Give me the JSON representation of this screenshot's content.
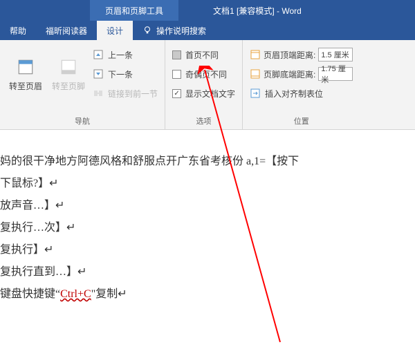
{
  "title": {
    "tool_tab": "页眉和页脚工具",
    "doc": "文档1 [兼容模式]  -  Word"
  },
  "tabs": {
    "help": "帮助",
    "foxit": "福昕阅读器",
    "design": "设计",
    "tell_me": "操作说明搜索"
  },
  "nav": {
    "goto_header": "转至页眉",
    "goto_footer": "转至页脚",
    "prev": "上一条",
    "next": "下一条",
    "link_prev": "链接到前一节",
    "group": "导航"
  },
  "options": {
    "diff_first": "首页不同",
    "diff_odd_even": "奇偶页不同",
    "show_doc": "显示文档文字",
    "group": "选项"
  },
  "position": {
    "header_dist": "页眉顶端距离:",
    "header_val": "1.5 厘米",
    "footer_dist": "页脚底端距离:",
    "footer_val": "1.75 厘米",
    "insert_tab": "插入对齐制表位",
    "group": "位置"
  },
  "doc": {
    "l1": "妈的很干净地方阿德风格和舒服点开广东省考核份 a,1=【按下",
    "l2": "下鼠标?】↵",
    "l3": "放声音…】↵",
    "l4": "复执行…次】↵",
    "l5": "复执行】↵",
    "l6": "复执行直到…】↵",
    "l7a": "键盘快捷键“",
    "l7b": "Ctrl+C",
    "l7c": "\"复制↵"
  }
}
